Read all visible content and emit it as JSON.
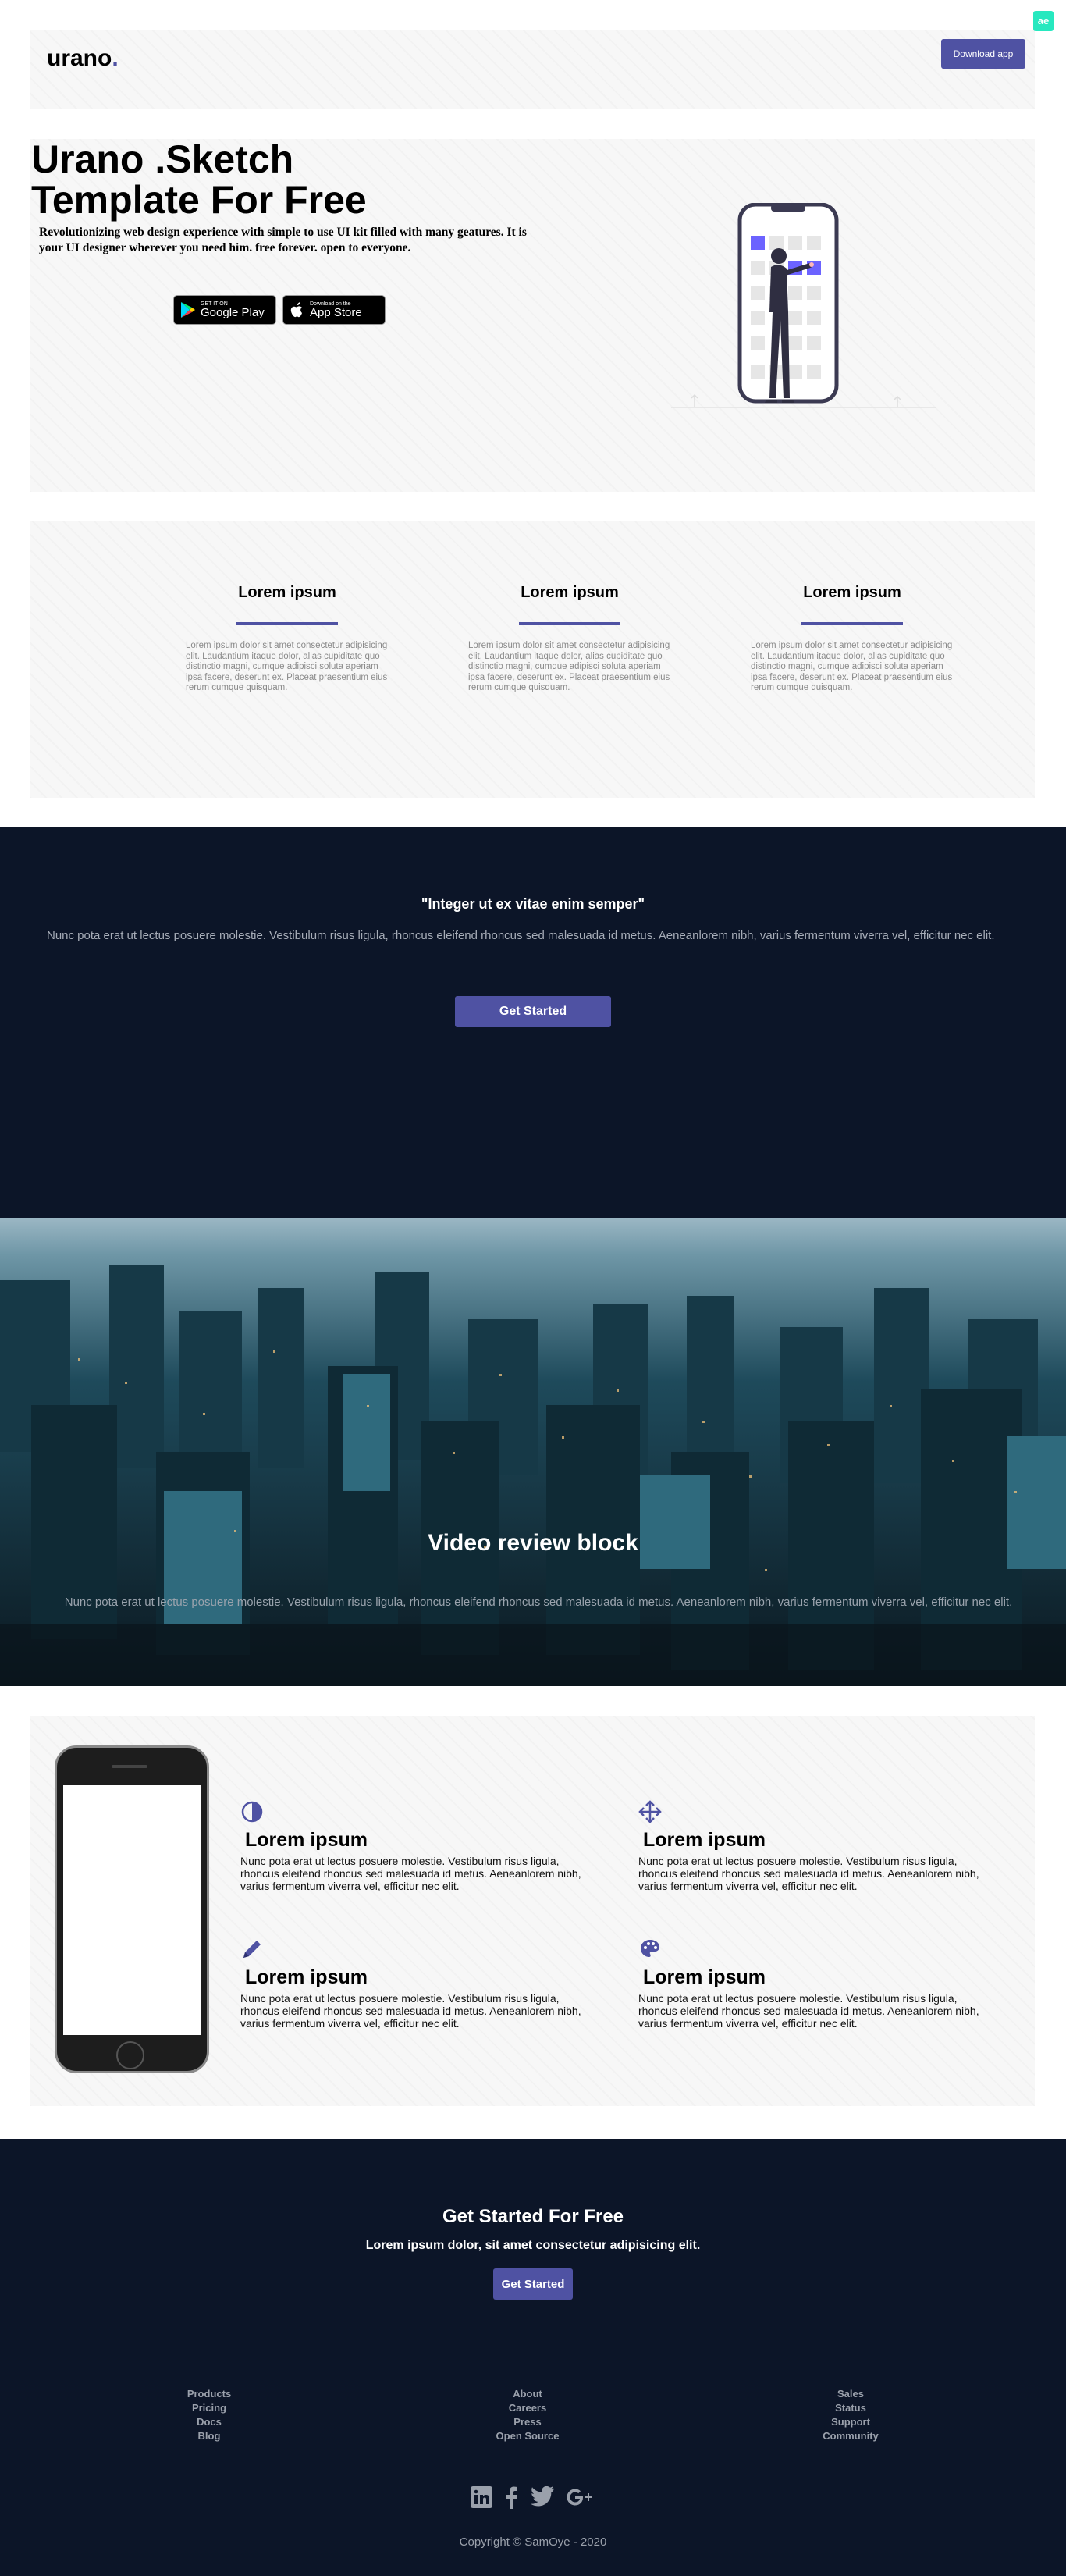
{
  "badge": "ae",
  "nav": {
    "logo": "urano",
    "logo_dot": ".",
    "download_label": "Download app"
  },
  "hero": {
    "title_line1": "Urano .Sketch",
    "title_line2": "Template For Free",
    "subtitle": "Revolutionizing web design experience with simple to use UI kit filled with many geatures. It is your UI designer wherever you need him. free forever. open to everyone.",
    "google_small": "GET IT ON",
    "google_big": "Google Play",
    "apple_small": "Download on the",
    "apple_big": "App Store"
  },
  "features": [
    {
      "title": "Lorem ipsum",
      "text": "Lorem ipsum dolor sit amet consectetur adipisicing elit. Laudantium itaque dolor, alias cupiditate quo distinctio magni, cumque adipisci soluta aperiam ipsa facere, deserunt ex. Placeat praesentium eius rerum cumque quisquam."
    },
    {
      "title": "Lorem ipsum",
      "text": "Lorem ipsum dolor sit amet consectetur adipisicing elit. Laudantium itaque dolor, alias cupiditate quo distinctio magni, cumque adipisci soluta aperiam ipsa facere, deserunt ex. Placeat praesentium eius rerum cumque quisquam."
    },
    {
      "title": "Lorem ipsum",
      "text": "Lorem ipsum dolor sit amet consectetur adipisicing elit. Laudantium itaque dolor, alias cupiditate quo distinctio magni, cumque adipisci soluta aperiam ipsa facere, deserunt ex. Placeat praesentium eius rerum cumque quisquam."
    }
  ],
  "quote": {
    "title": "\"Integer ut ex vitae enim semper\"",
    "text": "Nunc pota erat ut lectus posuere molestie. Vestibulum risus ligula, rhoncus eleifend rhoncus sed malesuada id metus. Aeneanlorem nibh, varius fermentum viverra vel, efficitur nec elit.",
    "button": "Get Started"
  },
  "video": {
    "title": "Video review block",
    "text": "Nunc pota erat ut lectus posuere molestie. Vestibulum risus ligula, rhoncus eleifend rhoncus sed malesuada id metus. Aeneanlorem nibh, varius fermentum viverra vel, efficitur nec elit."
  },
  "phone_features": [
    {
      "icon": "half-circle-icon",
      "title": "Lorem ipsum",
      "text": "Nunc pota erat ut lectus posuere molestie. Vestibulum risus ligula, rhoncus eleifend rhoncus sed malesuada id metus. Aeneanlorem nibh, varius fermentum viverra vel, efficitur nec elit."
    },
    {
      "icon": "move-arrows-icon",
      "title": "Lorem ipsum",
      "text": "Nunc pota erat ut lectus posuere molestie. Vestibulum risus ligula, rhoncus eleifend rhoncus sed malesuada id metus. Aeneanlorem nibh, varius fermentum viverra vel, efficitur nec elit."
    },
    {
      "icon": "pencil-icon",
      "title": "Lorem ipsum",
      "text": "Nunc pota erat ut lectus posuere molestie. Vestibulum risus ligula, rhoncus eleifend rhoncus sed malesuada id metus. Aeneanlorem nibh, varius fermentum viverra vel, efficitur nec elit."
    },
    {
      "icon": "palette-icon",
      "title": "Lorem ipsum",
      "text": "Nunc pota erat ut lectus posuere molestie. Vestibulum risus ligula, rhoncus eleifend rhoncus sed malesuada id metus. Aeneanlorem nibh, varius fermentum viverra vel, efficitur nec elit."
    }
  ],
  "footer": {
    "title": "Get Started For Free",
    "subtitle": "Lorem ipsum dolor, sit amet consectetur adipisicing elit.",
    "button": "Get Started",
    "columns": [
      [
        "Products",
        "Pricing",
        "Docs",
        "Blog"
      ],
      [
        "About",
        "Careers",
        "Press",
        "Open Source"
      ],
      [
        "Sales",
        "Status",
        "Support",
        "Community"
      ]
    ],
    "socials": [
      "linkedin-icon",
      "facebook-icon",
      "twitter-icon",
      "google-plus-icon"
    ],
    "copyright": "Copyright © SamOye - 2020"
  },
  "colors": {
    "accent": "#4f52a3",
    "dark_bg": "#0c1528",
    "badge": "#27e8bf"
  }
}
